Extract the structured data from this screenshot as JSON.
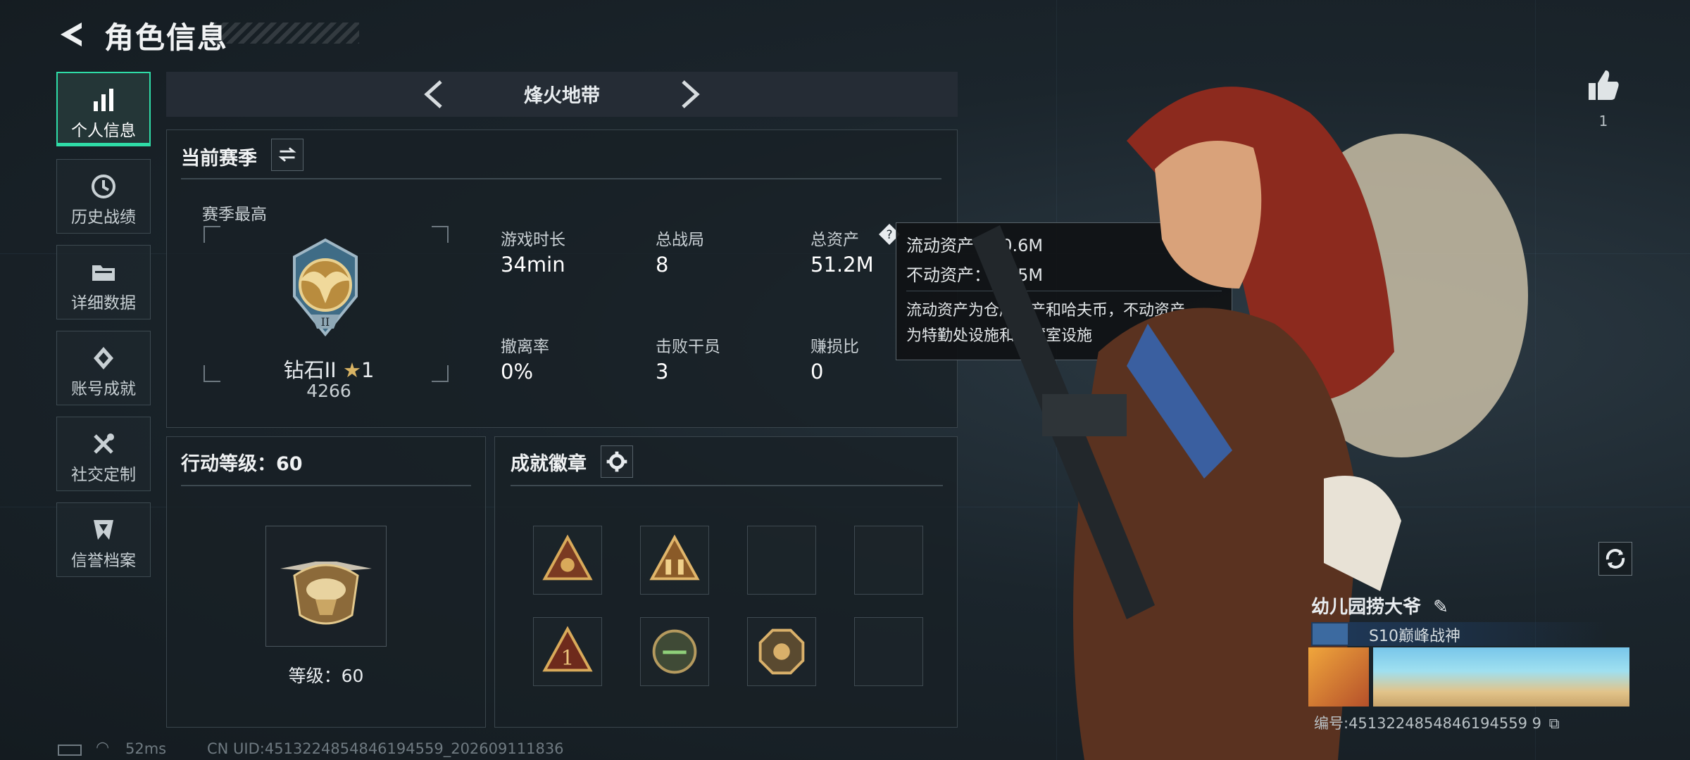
{
  "header": {
    "title": "角色信息"
  },
  "sidebar": {
    "items": [
      {
        "label": "个人信息",
        "icon": "bar-chart-icon",
        "active": true
      },
      {
        "label": "历史战绩",
        "icon": "history-clock-icon"
      },
      {
        "label": "详细数据",
        "icon": "folder-icon"
      },
      {
        "label": "账号成就",
        "icon": "achievement-icon"
      },
      {
        "label": "社交定制",
        "icon": "tools-icon"
      },
      {
        "label": "信誉档案",
        "icon": "credit-shield-icon"
      }
    ]
  },
  "mode": {
    "title": "烽火地带"
  },
  "season": {
    "title": "当前赛季",
    "best_label": "赛季最高",
    "rank_name": "钻石II",
    "rank_stars": "1",
    "rank_score": "4266",
    "stats": [
      {
        "label": "游戏时长",
        "value": "34min"
      },
      {
        "label": "总战局",
        "value": "8"
      },
      {
        "label": "总资产",
        "value": "51.2M"
      },
      {
        "label": "撤离率",
        "value": "0%"
      },
      {
        "label": "击败干员",
        "value": "3"
      },
      {
        "label": "赚损比",
        "value": "0"
      }
    ]
  },
  "tooltip": {
    "liquid": "流动资产：40.6M",
    "fixed": "不动资产：10.5M",
    "desc1": "流动资产为仓库资产和哈夫币，不动资产",
    "desc2": "为特勤处设施和收藏室设施"
  },
  "action_level": {
    "title": "行动等级：60",
    "level_text": "等级：60"
  },
  "badges": {
    "title": "成就徽章",
    "filled": [
      true,
      true,
      false,
      false,
      true,
      true,
      true,
      false
    ]
  },
  "profile": {
    "likes": "1",
    "nickname": "幼儿园捞大爷",
    "title_tag": "S10巅峰战神",
    "id_text": "编号:4513224854846194559 9"
  },
  "status": {
    "ping": "52ms",
    "uid": "CN UID:4513224854846194559_202609111836"
  },
  "colors": {
    "accent": "#2fdca7",
    "gold": "#c9a14a",
    "bg": "#1b252c"
  }
}
